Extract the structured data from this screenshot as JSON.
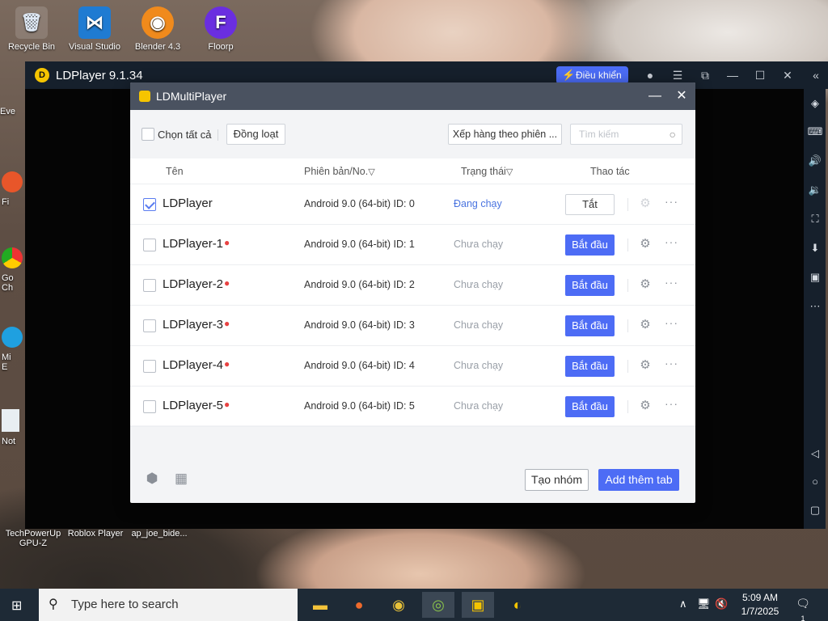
{
  "desktop": {
    "icons": [
      {
        "label": "Recycle Bin",
        "icon": "recycle-bin-icon"
      },
      {
        "label": "Visual Studio",
        "icon": "visual-studio-icon"
      },
      {
        "label": "Blender 4.3",
        "icon": "blender-icon"
      },
      {
        "label": "Floorp",
        "icon": "floorp-icon"
      }
    ],
    "partial_labels": [
      "Eve",
      "Fi",
      "Go",
      "Ch",
      "Mi",
      "E",
      "Not"
    ],
    "bottom_labels": [
      "TechPowerUp GPU-Z",
      "Roblox Player",
      "ap_joe_bide..."
    ]
  },
  "ldplayer": {
    "title": "LDPlayer 9.1.34",
    "control_button": "Điều khiển",
    "multiplayer": {
      "title": "LDMultiPlayer",
      "select_all": "Chọn tất cả",
      "batch_button": "Đồng loạt",
      "sort_button": "Xếp hàng theo phiên ...",
      "search_placeholder": "Tìm kiếm",
      "columns": {
        "name": "Tên",
        "version": "Phiên bản/No.",
        "status": "Trạng thái",
        "action": "Thao tác"
      },
      "rows": [
        {
          "name": "LDPlayer",
          "version": "Android 9.0 (64-bit) ID: 0",
          "status": "Đang chạy",
          "action": "Tắt",
          "checked": true
        },
        {
          "name": "LDPlayer-1",
          "version": "Android 9.0 (64-bit) ID: 1",
          "status": "Chưa chạy",
          "action": "Bắt đầu",
          "checked": false
        },
        {
          "name": "LDPlayer-2",
          "version": "Android 9.0 (64-bit) ID: 2",
          "status": "Chưa chạy",
          "action": "Bắt đầu",
          "checked": false
        },
        {
          "name": "LDPlayer-3",
          "version": "Android 9.0 (64-bit) ID: 3",
          "status": "Chưa chạy",
          "action": "Bắt đầu",
          "checked": false
        },
        {
          "name": "LDPlayer-4",
          "version": "Android 9.0 (64-bit) ID: 4",
          "status": "Chưa chạy",
          "action": "Bắt đầu",
          "checked": false
        },
        {
          "name": "LDPlayer-5",
          "version": "Android 9.0 (64-bit) ID: 5",
          "status": "Chưa chạy",
          "action": "Bắt đầu",
          "checked": false
        }
      ],
      "create_group_button": "Tạo nhóm",
      "add_tab_button": "Add thêm tab"
    }
  },
  "taskbar": {
    "search_placeholder": "Type here to search",
    "time": "5:09 AM",
    "date": "1/7/2025",
    "notification_count": "1"
  },
  "colors": {
    "accent": "#4d6cf5",
    "running": "#4a74e0",
    "stopped": "#9aa0a8",
    "title_bar": "#16202c"
  }
}
